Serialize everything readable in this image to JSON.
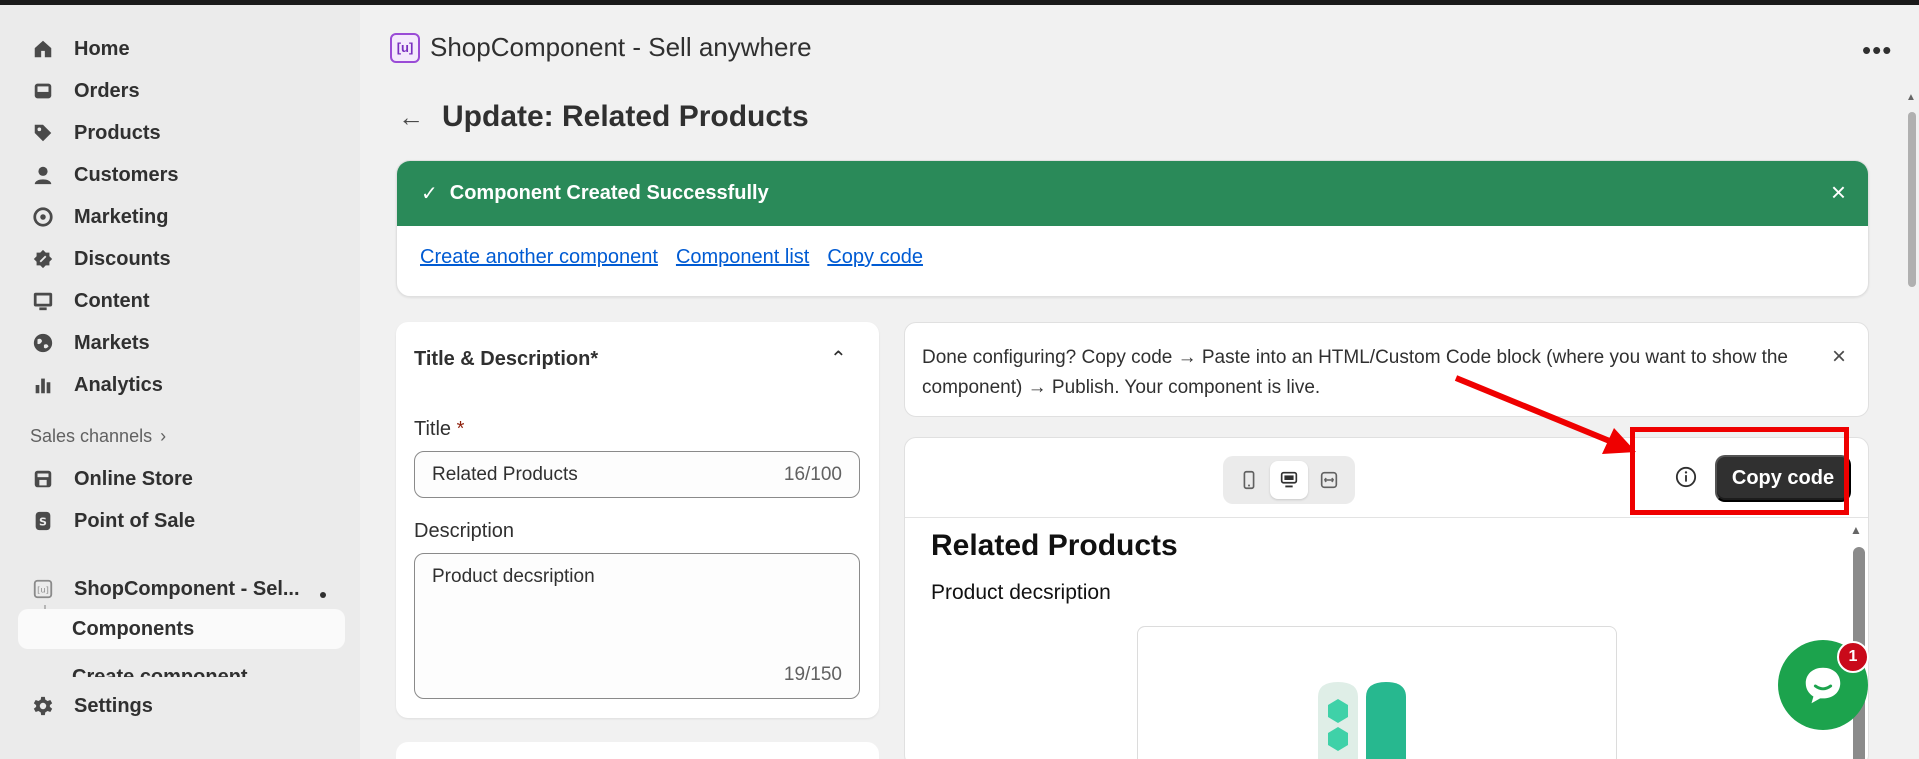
{
  "sidebar": {
    "items": [
      {
        "label": "Home",
        "icon": "home-icon"
      },
      {
        "label": "Orders",
        "icon": "inbox-icon"
      },
      {
        "label": "Products",
        "icon": "tag-icon"
      },
      {
        "label": "Customers",
        "icon": "person-icon"
      },
      {
        "label": "Marketing",
        "icon": "target-icon"
      },
      {
        "label": "Discounts",
        "icon": "discount-icon"
      },
      {
        "label": "Content",
        "icon": "image-icon"
      },
      {
        "label": "Markets",
        "icon": "globe-icon"
      },
      {
        "label": "Analytics",
        "icon": "bar-chart-icon"
      }
    ],
    "sales_channels_label": "Sales channels",
    "channels": [
      {
        "label": "Online Store",
        "icon": "store-icon"
      },
      {
        "label": "Point of Sale",
        "icon": "pos-icon"
      }
    ],
    "apps": {
      "app_label": "ShopComponent - Sel...",
      "components_label": "Components",
      "create_component_label": "Create component"
    },
    "settings_label": "Settings"
  },
  "header": {
    "app_title": "ShopComponent - Sell anywhere",
    "more_label": "•••"
  },
  "page": {
    "back_label": "←",
    "title": "Update: Related Products"
  },
  "banner": {
    "message": "Component Created Successfully",
    "links": [
      "Create another component",
      "Component list",
      "Copy code"
    ],
    "colors": {
      "success": "#2a8a59",
      "link": "#005bd3"
    }
  },
  "form": {
    "section_title": "Title & Description*",
    "title_label": "Title",
    "required_mark": "*",
    "title_value": "Related Products",
    "title_count": "16/100",
    "description_label": "Description",
    "description_value": "Product decsription",
    "description_count": "19/150"
  },
  "info": {
    "text": "Done configuring? Copy code → Paste into an HTML/Custom Code block (where you want to show the component) → Publish. Your component is live."
  },
  "preview": {
    "copy_button": "Copy code",
    "devices": [
      "mobile-icon",
      "desktop-icon",
      "full-width-icon"
    ],
    "selected_device": "desktop-icon",
    "heading": "Related Products",
    "description": "Product decsription"
  },
  "chat": {
    "badge": "1"
  },
  "annotations": {
    "highlight_color": "#ef0000"
  }
}
